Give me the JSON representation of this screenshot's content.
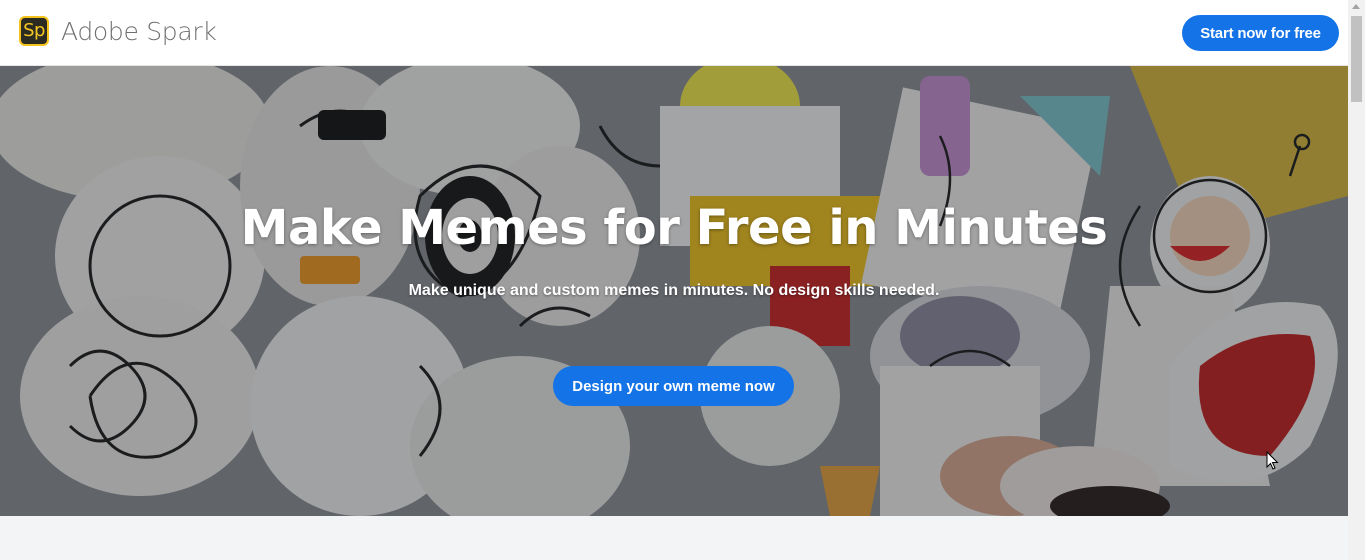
{
  "header": {
    "logo_text": "Sp",
    "brand_name": "Adobe Spark",
    "cta_label": "Start now for free"
  },
  "hero": {
    "title": "Make Memes for Free in Minutes",
    "subtitle": "Make unique and custom memes in minutes. No design skills needed.",
    "cta_label": "Design your own meme now",
    "background_icon": "sticker-collage-image"
  },
  "colors": {
    "accent": "#1473e6",
    "logo_bg": "#2b2b21",
    "logo_fg": "#f5c623"
  }
}
